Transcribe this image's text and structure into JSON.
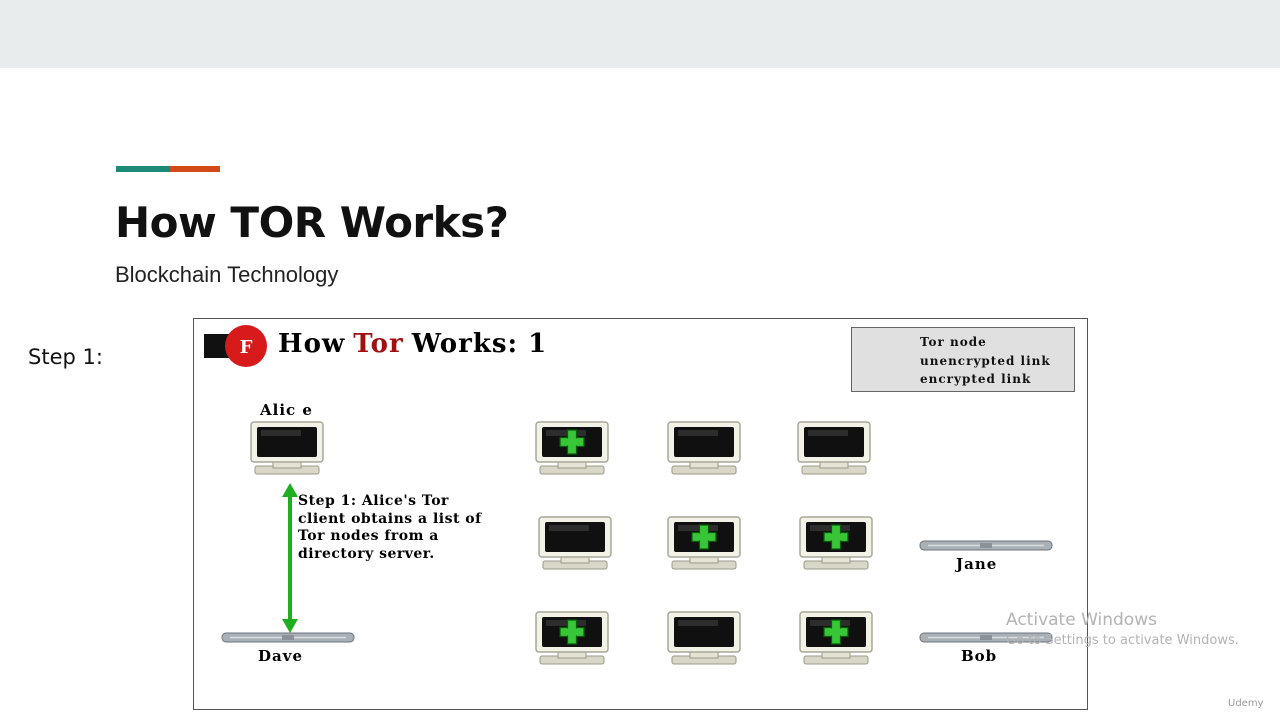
{
  "slide": {
    "title": "How TOR Works?",
    "subtitle": "Blockchain Technology",
    "step_label": "Step 1:"
  },
  "diagram": {
    "title_how": "How",
    "title_tor": "Tor",
    "title_works": "Works: 1",
    "logo_letters": "EFF",
    "legend": {
      "tor_node": "Tor node",
      "unencrypted_link": "unencrypted link",
      "encrypted_link": "encrypted link"
    },
    "nodes": {
      "alice": "Alic e",
      "dave": "Dave",
      "jane": "Jane",
      "bob": "Bob"
    },
    "step_text": "Step 1: Alice's Tor client obtains a list of Tor nodes from a directory server.",
    "colors": {
      "tor_red": "#a01010",
      "encrypted_green": "#1fae1f",
      "unencrypted_red": "#cc1111",
      "accent_teal": "#1d8a77",
      "accent_orange": "#d24a18"
    }
  },
  "watermark": {
    "line1": "Activate Windows",
    "line2": "Go to Settings to activate Windows."
  },
  "brand": "Udemy"
}
